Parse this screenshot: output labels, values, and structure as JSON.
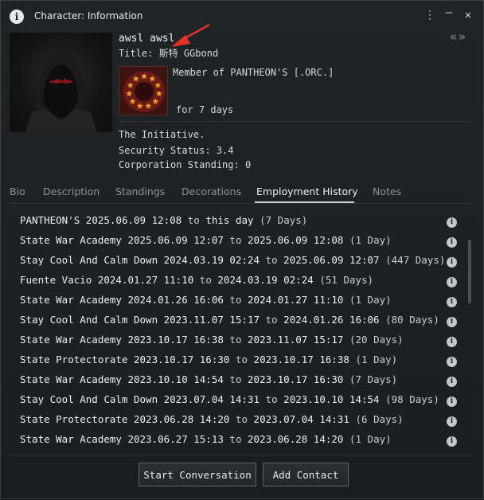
{
  "window": {
    "title": "Character: Information",
    "menu_icon": "kebab-menu-icon",
    "minimize_icon": "minimize-icon",
    "close_icon": "close-icon",
    "nav_back": "«",
    "nav_forward": "»"
  },
  "character": {
    "name": "awsl awsl",
    "title_label": "Title:",
    "title_value": "斯特  GGbond",
    "member_of": "Member of PANTHEON'S [.ORC.]",
    "member_duration": "for 7 days",
    "alliance": "The Initiative.",
    "security_status": "Security Status: 3.4",
    "corporation_standing": "Corporation Standing: 0"
  },
  "tabs": [
    {
      "label": "Bio"
    },
    {
      "label": "Description"
    },
    {
      "label": "Standings"
    },
    {
      "label": "Decorations"
    },
    {
      "label": "Employment History",
      "active": true
    },
    {
      "label": "Notes"
    }
  ],
  "employment_history": [
    {
      "corp": "PANTHEON'S",
      "from": "2025.06.09 12:08",
      "sep": "to",
      "to": "this day",
      "duration": "(7 Days)"
    },
    {
      "corp": "State War Academy",
      "from": "2025.06.09 12:07",
      "sep": "to",
      "to": "2025.06.09 12:08",
      "duration": "(1 Day)"
    },
    {
      "corp": "Stay Cool And Calm Down",
      "from": "2024.03.19 02:24",
      "sep": "to",
      "to": "2025.06.09 12:07",
      "duration": "(447 Days)"
    },
    {
      "corp": "Fuente Vacio",
      "from": "2024.01.27 11:10",
      "sep": "to",
      "to": "2024.03.19 02:24",
      "duration": "(51 Days)"
    },
    {
      "corp": "State War Academy",
      "from": "2024.01.26 16:06",
      "sep": "to",
      "to": "2024.01.27 11:10",
      "duration": "(1 Day)"
    },
    {
      "corp": "Stay Cool And Calm Down",
      "from": "2023.11.07 15:17",
      "sep": "to",
      "to": "2024.01.26 16:06",
      "duration": "(80 Days)"
    },
    {
      "corp": "State War Academy",
      "from": "2023.10.17 16:38",
      "sep": "to",
      "to": "2023.11.07 15:17",
      "duration": "(20 Days)"
    },
    {
      "corp": "State Protectorate",
      "from": "2023.10.17 16:30",
      "sep": "to",
      "to": "2023.10.17 16:38",
      "duration": "(1 Day)"
    },
    {
      "corp": "State War Academy",
      "from": "2023.10.10 14:54",
      "sep": "to",
      "to": "2023.10.17 16:30",
      "duration": "(7 Days)"
    },
    {
      "corp": "Stay Cool And Calm Down",
      "from": "2023.07.04 14:31",
      "sep": "to",
      "to": "2023.10.10 14:54",
      "duration": "(98 Days)"
    },
    {
      "corp": "State Protectorate",
      "from": "2023.06.28 14:20",
      "sep": "to",
      "to": "2023.07.04 14:31",
      "duration": "(6 Days)"
    },
    {
      "corp": "State War Academy",
      "from": "2023.06.27 15:13",
      "sep": "to",
      "to": "2023.06.28 14:20",
      "duration": "(1 Day)"
    }
  ],
  "buttons": {
    "start_conversation": "Start Conversation",
    "add_contact": "Add Contact"
  },
  "colors": {
    "annotation_arrow": "#e8302a",
    "corp_logo_bg": "#3a1411",
    "corp_logo_stars": "#f0a22a"
  }
}
